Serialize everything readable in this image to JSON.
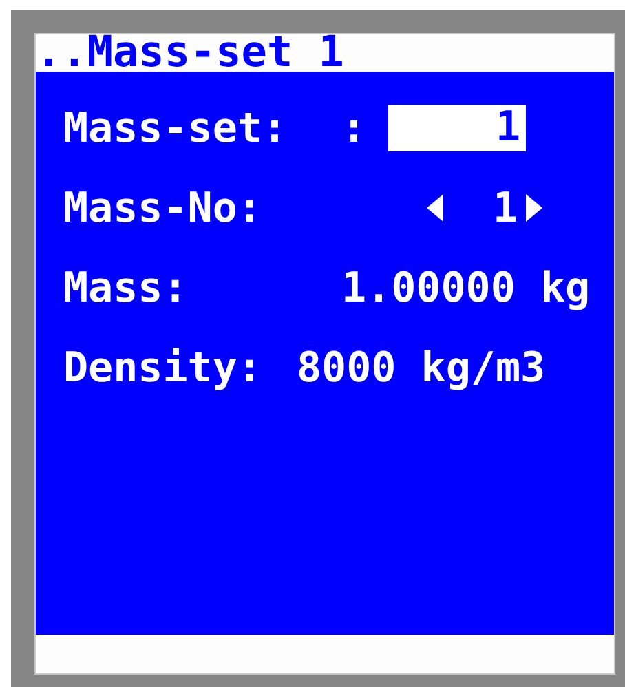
{
  "title": "..Mass-set 1",
  "fields": [
    {
      "kind": "input",
      "label": "Mass-set:",
      "separator": ":",
      "value": "1"
    },
    {
      "kind": "stepper",
      "label": "Mass-No:",
      "value": "1"
    },
    {
      "kind": "readout",
      "label": "Mass:",
      "value": "1.00000 kg"
    },
    {
      "kind": "pair",
      "label": "Density:",
      "value": "8000 kg/m3"
    }
  ]
}
